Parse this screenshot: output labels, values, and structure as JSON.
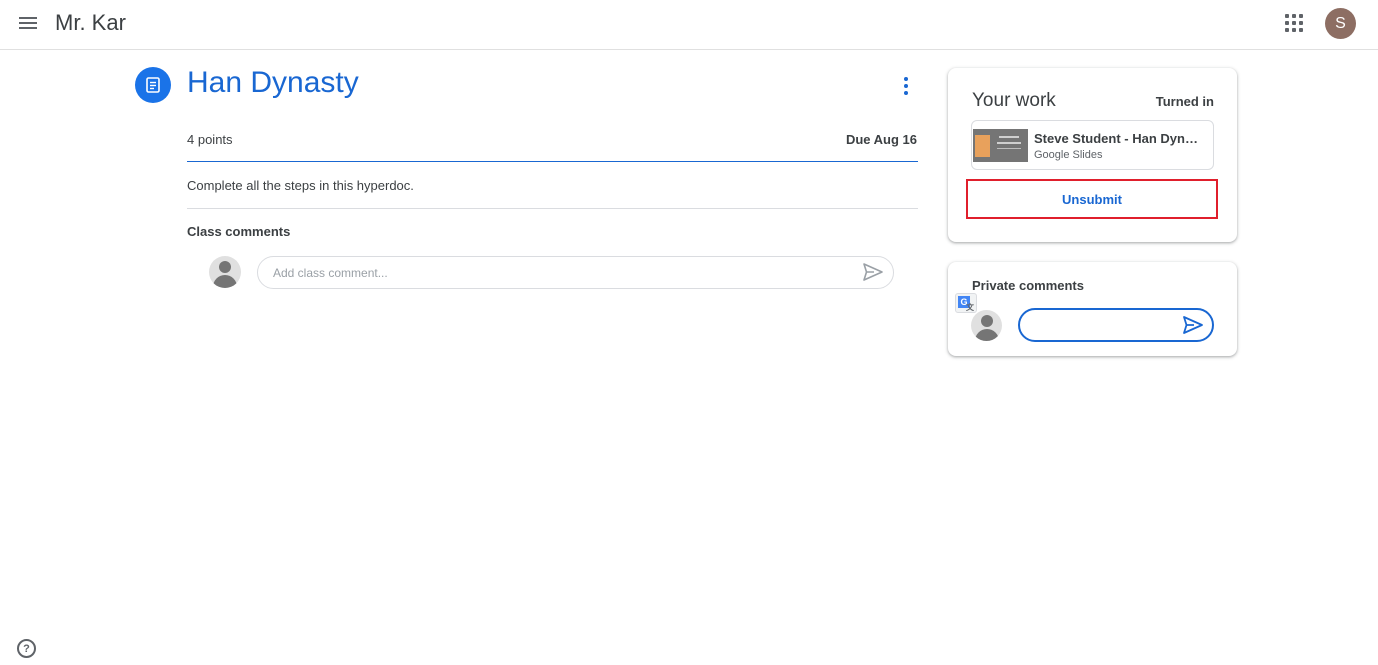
{
  "header": {
    "class_name": "Mr. Kar",
    "account_initial": "S"
  },
  "assignment": {
    "title": "Han Dynasty",
    "points": "4 points",
    "due": "Due Aug 16",
    "instructions": "Complete all the steps in this hyperdoc.",
    "class_comments_label": "Class comments",
    "class_comment_placeholder": "Add class comment..."
  },
  "your_work": {
    "title": "Your work",
    "status": "Turned in",
    "attachment": {
      "name": "Steve Student - Han Dynasty",
      "type": "Google Slides"
    },
    "unsubmit_label": "Unsubmit"
  },
  "private_comments": {
    "label": "Private comments",
    "input_value": ""
  },
  "help": {
    "symbol": "?"
  },
  "colors": {
    "accent": "#1967d2",
    "highlight_border": "#e01f2c",
    "avatar_bg": "#8d6e63"
  },
  "icons": {
    "menu": "hamburger-menu-icon",
    "apps": "apps-grid-icon",
    "assignment": "assignment-icon",
    "more": "more-vert-icon",
    "send": "send-icon",
    "translate": "translate-icon",
    "help": "help-icon"
  }
}
